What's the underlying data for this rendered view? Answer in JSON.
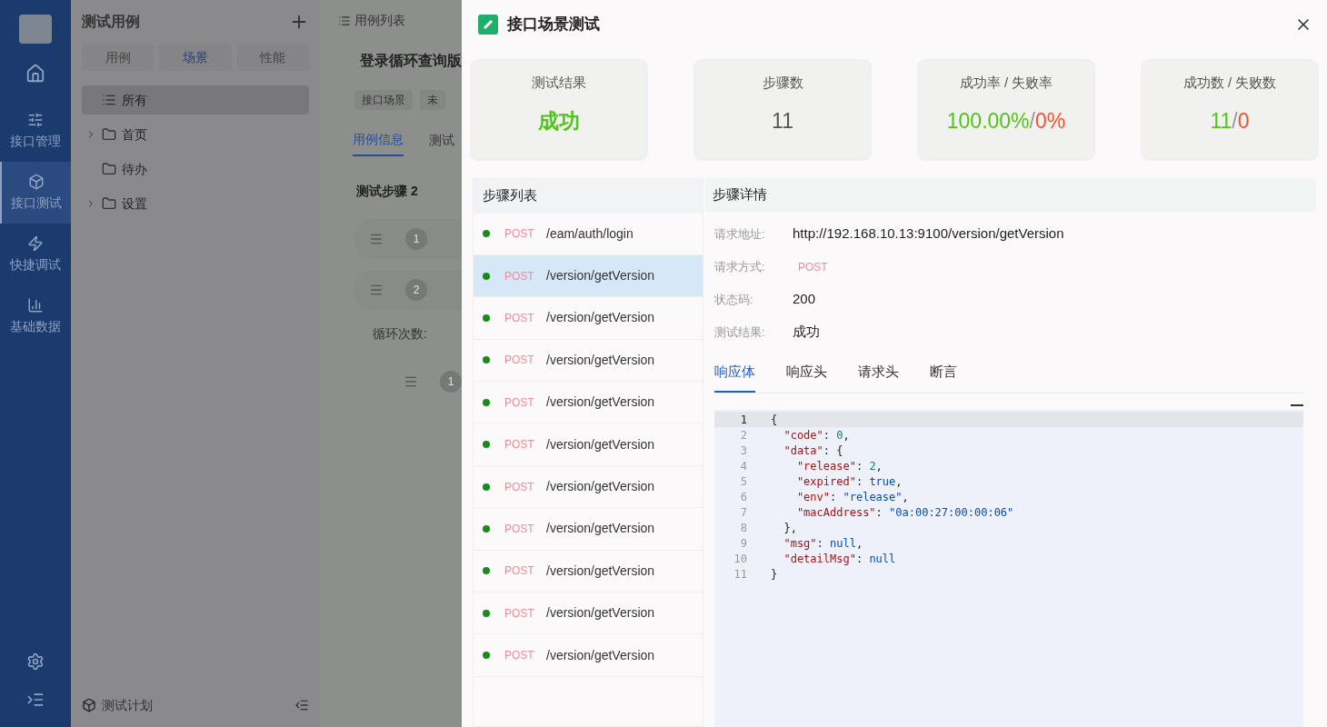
{
  "nav": {
    "items": [
      {
        "label": "接口管理",
        "selected": false
      },
      {
        "label": "接口测试",
        "selected": true
      },
      {
        "label": "快捷调试",
        "selected": false
      },
      {
        "label": "基础数据",
        "selected": false
      }
    ]
  },
  "tree_panel": {
    "title": "测试用例",
    "tabs": [
      {
        "label": "用例",
        "selected": false
      },
      {
        "label": "场景",
        "selected": true
      },
      {
        "label": "性能",
        "selected": false
      }
    ],
    "items": [
      {
        "label": "所有",
        "kind": "all",
        "selected": true,
        "expandable": false
      },
      {
        "label": "首页",
        "kind": "folder",
        "selected": false,
        "expandable": true
      },
      {
        "label": "待办",
        "kind": "folder",
        "selected": false,
        "expandable": false
      },
      {
        "label": "设置",
        "kind": "folder",
        "selected": false,
        "expandable": true
      }
    ],
    "footer": "测试计划"
  },
  "case_panel": {
    "header": "用例列表",
    "title": "登录循环查询版",
    "tags": [
      "接口场景",
      "未"
    ],
    "tabs": [
      {
        "label": "用例信息",
        "selected": true
      },
      {
        "label": "测试",
        "selected": false
      }
    ],
    "section": "测试步骤 2",
    "steps": [
      {
        "number": "1"
      },
      {
        "number": "2"
      }
    ],
    "loop_label": "循环次数:",
    "sub_steps": [
      {
        "number": "1"
      }
    ]
  },
  "drawer": {
    "title": "接口场景测试",
    "stats": [
      {
        "label": "测试结果",
        "parts": [
          {
            "text": "成功",
            "color": "#52c41a"
          }
        ]
      },
      {
        "label": "步骤数",
        "parts": [
          {
            "text": "11",
            "color": "#555555"
          }
        ]
      },
      {
        "label": "成功率 / 失败率",
        "parts": [
          {
            "text": "100.00%",
            "color": "#52c41a"
          },
          {
            "text": "/",
            "color": "#999999"
          },
          {
            "text": "0%",
            "color": "#f5522d"
          }
        ]
      },
      {
        "label": "成功数 / 失败数",
        "parts": [
          {
            "text": "11",
            "color": "#52c41a"
          },
          {
            "text": "/",
            "color": "#999999"
          },
          {
            "text": "0",
            "color": "#f5522d"
          }
        ]
      }
    ],
    "step_list": {
      "title": "步骤列表",
      "items": [
        {
          "method": "POST",
          "path": "/eam/auth/login",
          "color": "#1a8a1a",
          "selected": false
        },
        {
          "method": "POST",
          "path": "/version/getVersion",
          "color": "#1a8a1a",
          "selected": true
        },
        {
          "method": "POST",
          "path": "/version/getVersion",
          "color": "#1a8a1a",
          "selected": false
        },
        {
          "method": "POST",
          "path": "/version/getVersion",
          "color": "#1a8a1a",
          "selected": false
        },
        {
          "method": "POST",
          "path": "/version/getVersion",
          "color": "#1a8a1a",
          "selected": false
        },
        {
          "method": "POST",
          "path": "/version/getVersion",
          "color": "#1a8a1a",
          "selected": false
        },
        {
          "method": "POST",
          "path": "/version/getVersion",
          "color": "#1a8a1a",
          "selected": false
        },
        {
          "method": "POST",
          "path": "/version/getVersion",
          "color": "#1a8a1a",
          "selected": false
        },
        {
          "method": "POST",
          "path": "/version/getVersion",
          "color": "#1a8a1a",
          "selected": false
        },
        {
          "method": "POST",
          "path": "/version/getVersion",
          "color": "#1a8a1a",
          "selected": false
        },
        {
          "method": "POST",
          "path": "/version/getVersion",
          "color": "#1a8a1a",
          "selected": false
        }
      ]
    },
    "detail": {
      "title": "步骤详情",
      "fields": [
        {
          "label": "请求地址:",
          "value": "http://192.168.10.13:9100/version/getVersion",
          "kind": "text"
        },
        {
          "label": "请求方式:",
          "value": "POST",
          "kind": "method"
        },
        {
          "label": "状态码:",
          "value": "200",
          "kind": "text"
        },
        {
          "label": "测试结果:",
          "value": "成功",
          "kind": "text"
        }
      ],
      "tabs": [
        {
          "label": "响应体",
          "selected": true
        },
        {
          "label": "响应头",
          "selected": false
        },
        {
          "label": "请求头",
          "selected": false
        },
        {
          "label": "断言",
          "selected": false
        }
      ],
      "code": [
        {
          "n": "1",
          "tokens": [
            {
              "kind": "punct",
              "text": "{"
            }
          ]
        },
        {
          "n": "2",
          "tokens": [
            {
              "kind": "key",
              "text": "  \"code\""
            },
            {
              "kind": "punct",
              "text": ": "
            },
            {
              "kind": "number",
              "text": "0"
            },
            {
              "kind": "punct",
              "text": ","
            }
          ]
        },
        {
          "n": "3",
          "tokens": [
            {
              "kind": "key",
              "text": "  \"data\""
            },
            {
              "kind": "punct",
              "text": ": {"
            }
          ]
        },
        {
          "n": "4",
          "tokens": [
            {
              "kind": "key",
              "text": "    \"release\""
            },
            {
              "kind": "punct",
              "text": ": "
            },
            {
              "kind": "number",
              "text": "2"
            },
            {
              "kind": "punct",
              "text": ","
            }
          ]
        },
        {
          "n": "5",
          "tokens": [
            {
              "kind": "key",
              "text": "    \"expired\""
            },
            {
              "kind": "punct",
              "text": ": "
            },
            {
              "kind": "literal",
              "text": "true"
            },
            {
              "kind": "punct",
              "text": ","
            }
          ]
        },
        {
          "n": "6",
          "tokens": [
            {
              "kind": "key",
              "text": "    \"env\""
            },
            {
              "kind": "punct",
              "text": ": "
            },
            {
              "kind": "string",
              "text": "\"release\""
            },
            {
              "kind": "punct",
              "text": ","
            }
          ]
        },
        {
          "n": "7",
          "tokens": [
            {
              "kind": "key",
              "text": "    \"macAddress\""
            },
            {
              "kind": "punct",
              "text": ": "
            },
            {
              "kind": "string",
              "text": "\"0a:00:27:00:00:06\""
            }
          ]
        },
        {
          "n": "8",
          "tokens": [
            {
              "kind": "punct",
              "text": "  },"
            }
          ]
        },
        {
          "n": "9",
          "tokens": [
            {
              "kind": "key",
              "text": "  \"msg\""
            },
            {
              "kind": "punct",
              "text": ": "
            },
            {
              "kind": "literal",
              "text": "null"
            },
            {
              "kind": "punct",
              "text": ","
            }
          ]
        },
        {
          "n": "10",
          "tokens": [
            {
              "kind": "key",
              "text": "  \"detailMsg\""
            },
            {
              "kind": "punct",
              "text": ": "
            },
            {
              "kind": "literal",
              "text": "null"
            }
          ]
        },
        {
          "n": "11",
          "tokens": [
            {
              "kind": "punct",
              "text": "}"
            }
          ]
        }
      ]
    }
  }
}
